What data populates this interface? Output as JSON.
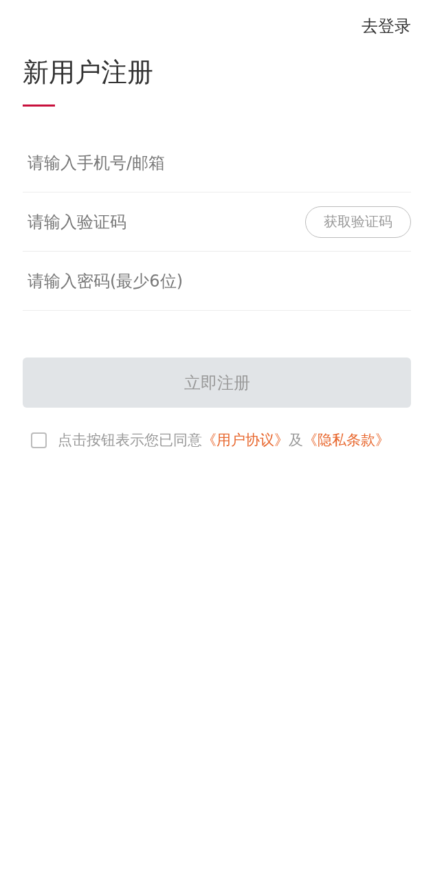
{
  "header": {
    "login_link": "去登录"
  },
  "title": "新用户注册",
  "fields": [
    {
      "kind": "account",
      "placeholder": "请输入手机号/邮箱"
    },
    {
      "kind": "code",
      "placeholder": "请输入验证码",
      "button": "获取验证码"
    },
    {
      "kind": "password",
      "placeholder": "请输入密码(最少6位)"
    }
  ],
  "register_button": {
    "label": "立即注册",
    "disabled": true
  },
  "agreement": {
    "checked": false,
    "text": "点击按钮表示您已同意",
    "link_1": "《用户协议》",
    "conjunction": "及",
    "link_2": "《隐私条款》"
  }
}
